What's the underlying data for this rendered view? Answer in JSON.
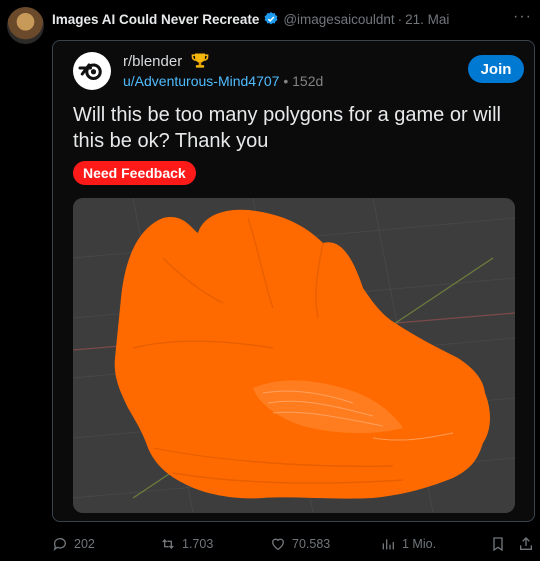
{
  "tweet": {
    "author": "Images AI Could Never Recreate",
    "handle": "@imagesaicouldnt",
    "date": "21. Mai",
    "more": "···",
    "replies": "202",
    "reposts": "1.703",
    "likes": "70.583",
    "views": "1 Mio."
  },
  "reddit": {
    "subreddit": "r/blender",
    "user": "u/Adventurous-Mind4707",
    "age": "152d",
    "join_label": "Join",
    "title": "Will this be too many polygons for a game or will this be ok? Thank you",
    "flair": "Need Feedback"
  },
  "colors": {
    "accent_blue": "#1d9bf0",
    "reddit_join": "#0079d3",
    "flair_red": "#ff1a1a",
    "model_orange": "#ff6a00",
    "viewport_gray": "#3d3d3d"
  },
  "icons": [
    "verified-badge-icon",
    "blender-logo-icon",
    "trophy-icon",
    "reply-icon",
    "repost-icon",
    "like-icon",
    "views-icon",
    "bookmark-icon",
    "share-icon"
  ]
}
